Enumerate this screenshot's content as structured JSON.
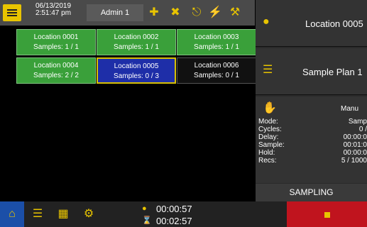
{
  "header": {
    "date": "06/13/2019",
    "time": "2:51:47 pm",
    "user": "Admin 1"
  },
  "locations": [
    {
      "name": "Location 0001",
      "samples": "Samples: 1 / 1",
      "state": "green"
    },
    {
      "name": "Location 0002",
      "samples": "Samples: 1 / 1",
      "state": "green"
    },
    {
      "name": "Location 0003",
      "samples": "Samples: 1 / 1",
      "state": "green"
    },
    {
      "name": "Location 0004",
      "samples": "Samples: 2 / 2",
      "state": "green"
    },
    {
      "name": "Location 0005",
      "samples": "Samples: 0 / 3",
      "state": "selected"
    },
    {
      "name": "Location 0006",
      "samples": "Samples: 0 / 1",
      "state": "dark"
    }
  ],
  "side": {
    "location": "Location 0005",
    "plan": "Sample Plan 1",
    "mode_value": "Manu",
    "stats": [
      {
        "label": "Mode:",
        "value": "Samp"
      },
      {
        "label": "Cycles:",
        "value": "0 /"
      },
      {
        "label": "Delay:",
        "value": "00:00:0"
      },
      {
        "label": "Sample:",
        "value": "00:01:0"
      },
      {
        "label": "Hold:",
        "value": "00:00:0"
      },
      {
        "label": "Recs:",
        "value": "5 / 1000"
      }
    ],
    "status": "SAMPLING"
  },
  "timers": {
    "elapsed": "00:00:57",
    "remaining": "00:02:57"
  },
  "colors": {
    "accent": "#e8c400",
    "tile_done": "#3aa03a",
    "tile_selected": "#1e2ea8",
    "stop": "#c0141e"
  }
}
